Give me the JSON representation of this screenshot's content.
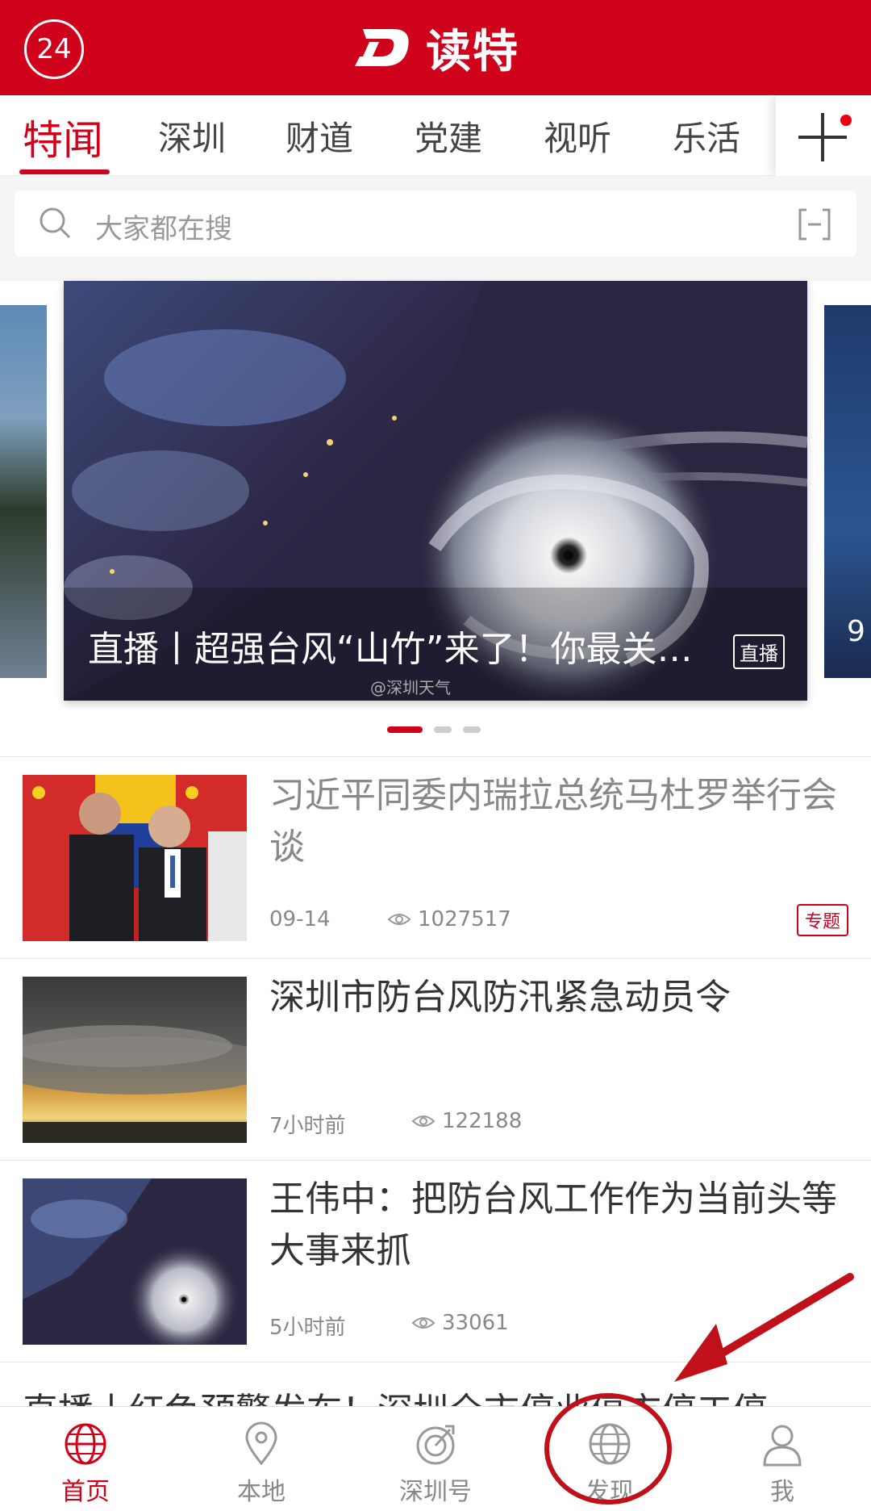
{
  "header": {
    "badge": "24",
    "logo_text": "读特"
  },
  "tabs": [
    {
      "label": "特闻"
    },
    {
      "label": "深圳"
    },
    {
      "label": "财道"
    },
    {
      "label": "党建"
    },
    {
      "label": "视听"
    },
    {
      "label": "乐活"
    }
  ],
  "search": {
    "placeholder": "大家都在搜"
  },
  "carousel": {
    "caption": "直播丨超强台风“山竹”来了！你最关…",
    "tag": "直播",
    "watermark": "@深圳天气",
    "side_text": "9"
  },
  "news": [
    {
      "title": "习近平同委内瑞拉总统马杜罗举行会谈",
      "time": "09-14",
      "views": "1027517",
      "tag": "专题"
    },
    {
      "title": "深圳市防台风防汛紧急动员令",
      "time": "7小时前",
      "views": "122188"
    },
    {
      "title": "王伟中：把防台风工作作为当前头等大事来抓",
      "time": "5小时前",
      "views": "33061"
    }
  ],
  "partial_news": {
    "title": "直播丨红色预警发布！深圳全市停业停市停工停"
  },
  "bottom_nav": [
    {
      "label": "首页",
      "icon": "globe-icon"
    },
    {
      "label": "本地",
      "icon": "location-pin-icon"
    },
    {
      "label": "深圳号",
      "icon": "target-icon"
    },
    {
      "label": "发现",
      "icon": "globe-icon"
    },
    {
      "label": "我",
      "icon": "person-icon"
    }
  ],
  "colors": {
    "brand_red": "#d0021b",
    "annotation_red": "#c0101a"
  }
}
